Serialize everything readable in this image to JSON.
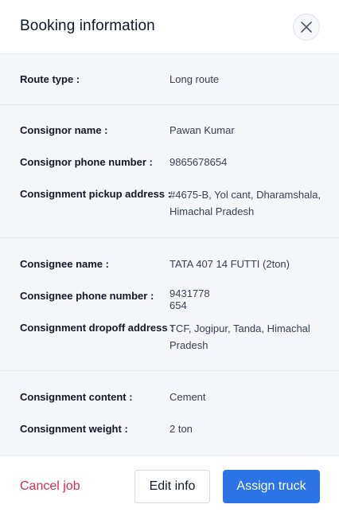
{
  "header": {
    "title": "Booking information",
    "close_icon": "close-icon"
  },
  "route": {
    "type_label": "Route type :",
    "type_value": "Long route"
  },
  "consignor": {
    "name_label": "Consignor name :",
    "name_value": "Pawan Kumar",
    "phone_label": "Consignor phone number :",
    "phone_value": "9865678654",
    "pickup_label": "Consignment pickup address :",
    "pickup_value": "#4675-B, Yol cant, Dharamshala, Himachal Pradesh"
  },
  "consignee": {
    "name_label": "Consignee name :",
    "name_value": "TATA 407 14 FUTTI (2ton)",
    "phone_label": "Consignee phone number :",
    "phone_value_line1": "9431778",
    "phone_value_line2": "654",
    "dropoff_label": "Consignment dropoff address :",
    "dropoff_value": "TCF, Jogipur, Tanda, Himachal Pradesh"
  },
  "consignment": {
    "content_label": "Consignment content :",
    "content_value": "Cement",
    "weight_label": "Consignment weight :",
    "weight_value": "2 ton"
  },
  "footer": {
    "cancel_label": "Cancel job",
    "edit_label": "Edit info",
    "assign_label": "Assign truck"
  },
  "colors": {
    "accent": "#2c74e6",
    "danger": "#d72b54",
    "panel_background": "#f5f6fa"
  }
}
